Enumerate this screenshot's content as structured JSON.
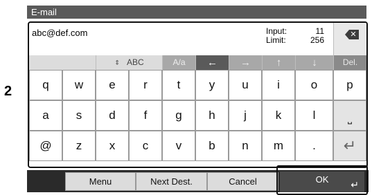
{
  "callout_number": "2",
  "title": "E-mail",
  "input": {
    "value": "abc@def.com",
    "input_label": "Input:",
    "input_count": "11",
    "limit_label": "Limit:",
    "limit_count": "256"
  },
  "delete_label": "Del.",
  "toolbar": {
    "mode_label": "ABC",
    "case_label": "A/a",
    "left_arrow": "←",
    "right_arrow": "→",
    "up_arrow": "↑",
    "down_arrow": "↓"
  },
  "rows": {
    "row1": [
      "q",
      "w",
      "e",
      "r",
      "t",
      "y",
      "u",
      "i",
      "o",
      "p"
    ],
    "row2": [
      "a",
      "s",
      "d",
      "f",
      "g",
      "h",
      "j",
      "k",
      "l"
    ],
    "row3": [
      "@",
      "z",
      "x",
      "c",
      "v",
      "b",
      "n",
      "m",
      "."
    ]
  },
  "space_glyph": "⎵",
  "enter_glyph": "↵",
  "bottom": {
    "menu_label": "Menu",
    "next_dest_label": "Next Dest.",
    "cancel_label": "Cancel",
    "ok_label": "OK",
    "ok_return_glyph": "↵"
  },
  "colors": {
    "title_bg": "#5a5a5a",
    "bottom_bar": "#2a2a2a",
    "ok_bg": "#4a4a4a"
  }
}
